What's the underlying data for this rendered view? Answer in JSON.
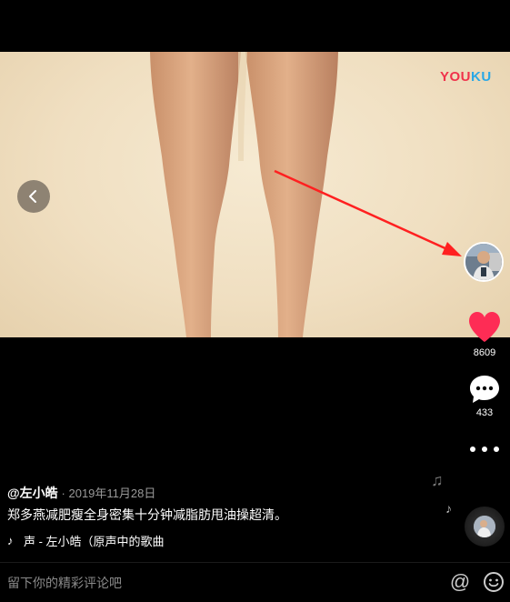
{
  "video": {
    "watermark": "YOUKU",
    "watermark_parts": [
      "YOU",
      "KU"
    ]
  },
  "nav": {
    "back_icon": "chevron-left-icon"
  },
  "sidebar": {
    "avatar_icon": "creator-avatar",
    "like_count": "8609",
    "comment_count": "433",
    "like_color": "#fe2c55"
  },
  "post": {
    "author": "@左小皓",
    "date": "· 2019年11月28日",
    "caption": "郑多燕减肥瘦全身密集十分钟减脂肪甩油操超清。",
    "music": "声 - 左小皓（原声中的歌曲"
  },
  "comment_bar": {
    "placeholder": "留下你的精彩评论吧",
    "at_symbol": "@"
  }
}
